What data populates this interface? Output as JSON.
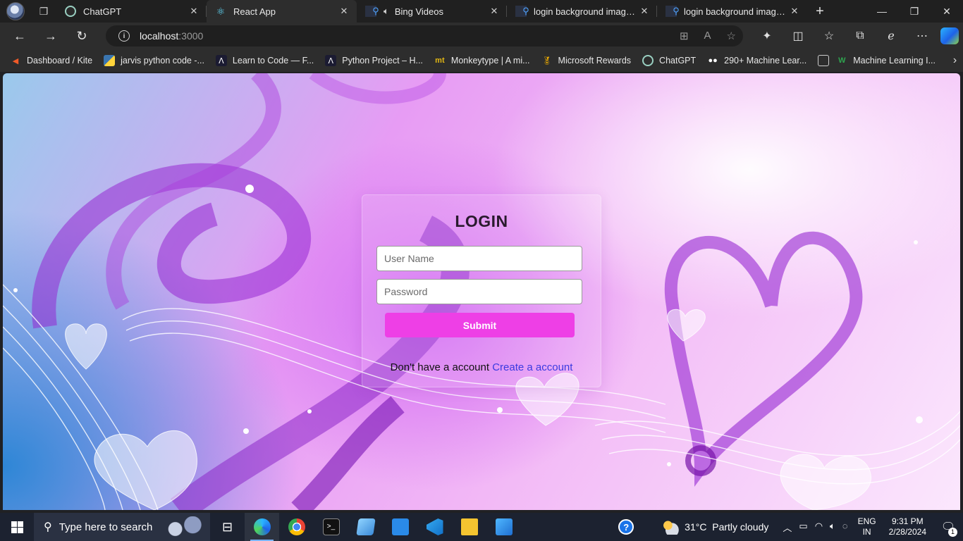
{
  "browser": {
    "tabs": [
      {
        "title": "ChatGPT",
        "icon": "chatgpt-icon"
      },
      {
        "title": "React App",
        "icon": "react-icon",
        "active": true
      },
      {
        "title": "Bing Videos",
        "icon": "search-icon"
      },
      {
        "title": "login background images -",
        "icon": "search-icon"
      },
      {
        "title": "login background images -",
        "icon": "search-icon"
      }
    ],
    "address": {
      "host": "localhost",
      "port": ":3000"
    },
    "bookmarks": [
      {
        "label": "Dashboard / Kite",
        "icon": "kite-icon"
      },
      {
        "label": "jarvis python code -...",
        "icon": "python-icon"
      },
      {
        "label": "Learn to Code — F...",
        "icon": "freecodecamp-icon"
      },
      {
        "label": "Python Project – H...",
        "icon": "freecodecamp-icon"
      },
      {
        "label": "Monkeytype | A mi...",
        "icon": "monkeytype-icon"
      },
      {
        "label": "Microsoft Rewards",
        "icon": "medal-icon"
      },
      {
        "label": "ChatGPT",
        "icon": "chatgpt-icon"
      },
      {
        "label": "290+ Machine Lear...",
        "icon": "medium-icon"
      },
      {
        "label": "Machine Learning I...",
        "icon": "w-icon"
      }
    ]
  },
  "login": {
    "title": "LOGIN",
    "username_placeholder": "User Name",
    "password_placeholder": "Password",
    "submit_label": "Submit",
    "footer_text": "Don't have a account ",
    "create_link": "Create a account"
  },
  "taskbar": {
    "search_placeholder": "Type here to search",
    "weather": {
      "temp": "31°C",
      "condition": "Partly cloudy"
    },
    "lang_line1": "ENG",
    "lang_line2": "IN",
    "time": "9:31 PM",
    "date": "2/28/2024",
    "notifications": "1"
  },
  "colors": {
    "accent_button": "#ee3fe6",
    "link": "#3a3ae0"
  }
}
